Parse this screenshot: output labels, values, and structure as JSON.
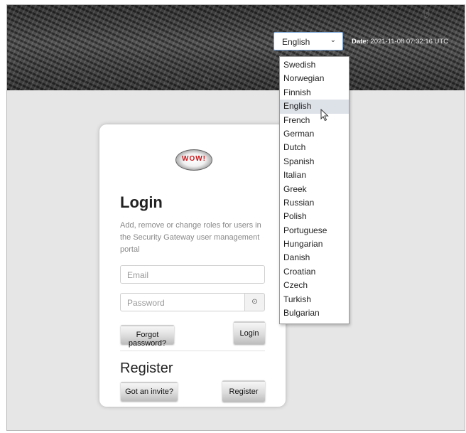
{
  "header": {
    "date_label": "Date:",
    "date_value": "2021-11-08 07:32:16 UTC",
    "decoration_left": "1 1 1  0  1  10  0",
    "decoration_right": "0"
  },
  "language_select": {
    "value": "English",
    "chevron": "⌄",
    "options": [
      "Swedish",
      "Norwegian",
      "Finnish",
      "English",
      "French",
      "German",
      "Dutch",
      "Spanish",
      "Italian",
      "Greek",
      "Russian",
      "Polish",
      "Portuguese",
      "Hungarian",
      "Danish",
      "Croatian",
      "Czech",
      "Turkish",
      "Bulgarian"
    ],
    "highlighted": "English"
  },
  "login": {
    "logo_text": "WOW!",
    "title": "Login",
    "description": "Add, remove or change roles for users in the Security Gateway user management portal",
    "email_placeholder": "Email",
    "password_placeholder": "Password",
    "eye_icon": "⊙",
    "forgot_label": "Forgot password?",
    "login_label": "Login"
  },
  "register": {
    "title": "Register",
    "invite_label": "Got an invite?",
    "register_label": "Register"
  },
  "colors": {
    "background": "#e6e6e6",
    "select_border": "#7aa7d9",
    "highlight": "#dde1e8",
    "logo_red": "#c6171b"
  }
}
